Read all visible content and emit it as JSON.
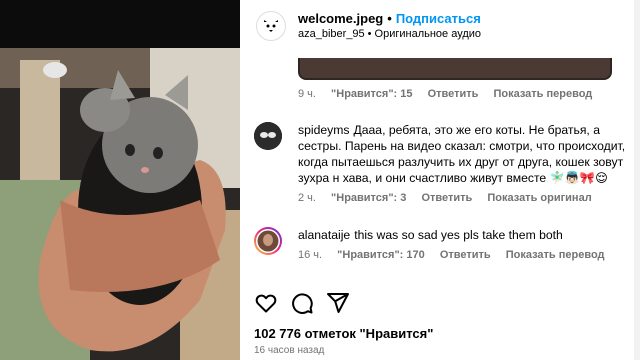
{
  "post": {
    "author": "welcome.jpeg",
    "follow_label": "Подписаться",
    "audio_user": "aza_biber_95",
    "audio_label": "Оригинальное аудио"
  },
  "first_comment_meta": {
    "time": "9 ч.",
    "likes": "\"Нравится\": 15",
    "reply": "Ответить",
    "translate": "Показать перевод"
  },
  "comments": [
    {
      "username": "spideyms",
      "text": "Дааа, ребята, это же его коты. Не братья, а сестры. Парень на видео сказал: смотри, что происходит, когда пытаешься разлучить их друг от друга, кошек зовут зухра н хава, и они счастливо живут вместе 🧚🏻‍♂️👼🏻🎀😌",
      "time": "2 ч.",
      "likes": "\"Нравится\": 3",
      "reply": "Ответить",
      "translate": "Показать оригинал"
    },
    {
      "username": "alanataije",
      "text": "this was so sad yes pls take them both",
      "time": "16 ч.",
      "likes": "\"Нравится\": 170",
      "reply": "Ответить",
      "translate": "Показать перевод"
    }
  ],
  "likes_total": "102 776 отметок \"Нравится\"",
  "posted_ago": "16 часов назад",
  "icons": {
    "like": "heart-icon",
    "comment": "comment-bubble-icon",
    "share": "paper-plane-icon"
  }
}
